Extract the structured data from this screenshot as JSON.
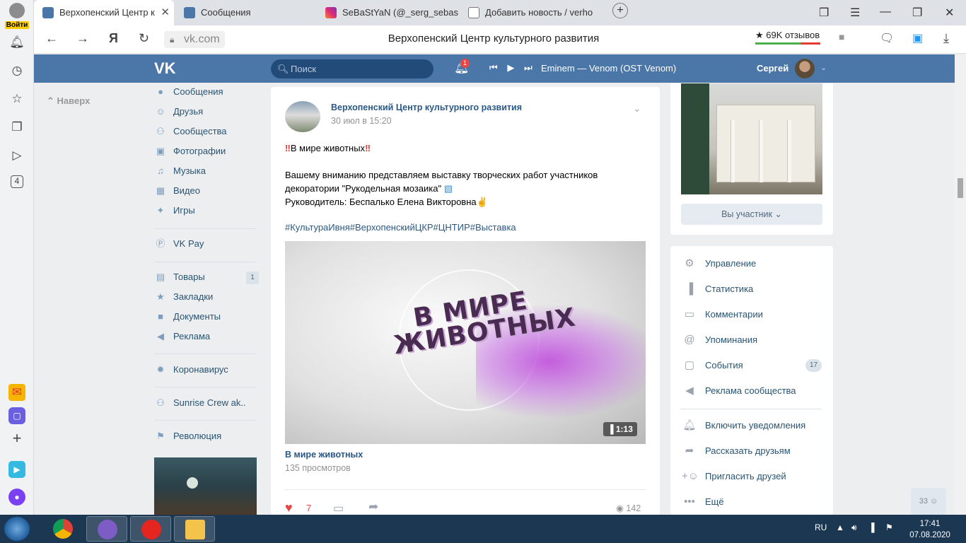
{
  "browser": {
    "login_label": "Войти",
    "tabs": [
      {
        "title": "Верхопенский Центр к",
        "color": "#4a76a8"
      },
      {
        "title": "Сообщения",
        "color": "#4a76a8"
      },
      {
        "title": "SeBaStYaN (@_serg_sebast",
        "color": "#d6249f"
      },
      {
        "title": "Добавить новость / verho",
        "color": "#777777"
      }
    ],
    "url": "vk.com",
    "page_title": "Верхопенский Центр культурного развития",
    "reviews": "★ 69K отзывов",
    "rail_badge": "4"
  },
  "vk": {
    "search_placeholder": "Поиск",
    "notif_count": "1",
    "track": "Eminem — Venom (OST Venom)",
    "user_name": "Сергей",
    "back_to_top": "Наверх",
    "menu": [
      {
        "label": "Сообщения",
        "icon": "chat-icon"
      },
      {
        "label": "Друзья",
        "icon": "user-icon"
      },
      {
        "label": "Сообщества",
        "icon": "users-icon"
      },
      {
        "label": "Фотографии",
        "icon": "camera-icon"
      },
      {
        "label": "Музыка",
        "icon": "music-icon"
      },
      {
        "label": "Видео",
        "icon": "film-icon"
      },
      {
        "label": "Игры",
        "icon": "gamepad-icon"
      },
      {
        "label": "VK Pay",
        "icon": "vkpay-icon"
      },
      {
        "label": "Товары",
        "icon": "bag-icon",
        "badge": "1"
      },
      {
        "label": "Закладки",
        "icon": "star-icon"
      },
      {
        "label": "Документы",
        "icon": "doc-icon"
      },
      {
        "label": "Реклама",
        "icon": "megaphone-icon"
      },
      {
        "label": "Коронавирус",
        "icon": "virus-icon"
      },
      {
        "label": "Sunrise Crew ak..",
        "icon": "group-icon"
      },
      {
        "label": "Революция",
        "icon": "game-icon"
      }
    ],
    "post": {
      "author": "Верхопенский Центр культурного развития",
      "date": "30 июл в 15:20",
      "headline_text": "В мире животных",
      "body_line1": "Вашему вниманию представляем выставку творческих работ участников декоратории \"Рукодельная мозаика\"",
      "body_line2": "Руководитель: Беспалько Елена Викторовна",
      "hashtags": "#КультураИвня#ВерхопенскийЦКР#ЦНТИР#Выставка",
      "video_overlay": "В МИРЕ ЖИВОТНЫХ",
      "video_duration": "1:13",
      "video_title": "В мире животных",
      "video_views": "135 просмотров",
      "likes": "7",
      "views": "142"
    },
    "member_button": "Вы участник",
    "admin_menu": [
      {
        "label": "Управление",
        "icon": "gear-icon"
      },
      {
        "label": "Статистика",
        "icon": "chart-icon"
      },
      {
        "label": "Комментарии",
        "icon": "comment-icon"
      },
      {
        "label": "Упоминания",
        "icon": "at-icon"
      },
      {
        "label": "События",
        "icon": "calendar-icon",
        "badge": "17"
      },
      {
        "label": "Реклама сообщества",
        "icon": "megaphone-icon"
      },
      {
        "label": "Включить уведомления",
        "icon": "bell-icon"
      },
      {
        "label": "Рассказать друзьям",
        "icon": "share-icon"
      },
      {
        "label": "Пригласить друзей",
        "icon": "add-user-icon"
      },
      {
        "label": "Ещё",
        "icon": "more-icon"
      }
    ],
    "friends_online": "33"
  },
  "taskbar": {
    "lang": "RU",
    "time": "17:41",
    "date": "07.08.2020"
  }
}
